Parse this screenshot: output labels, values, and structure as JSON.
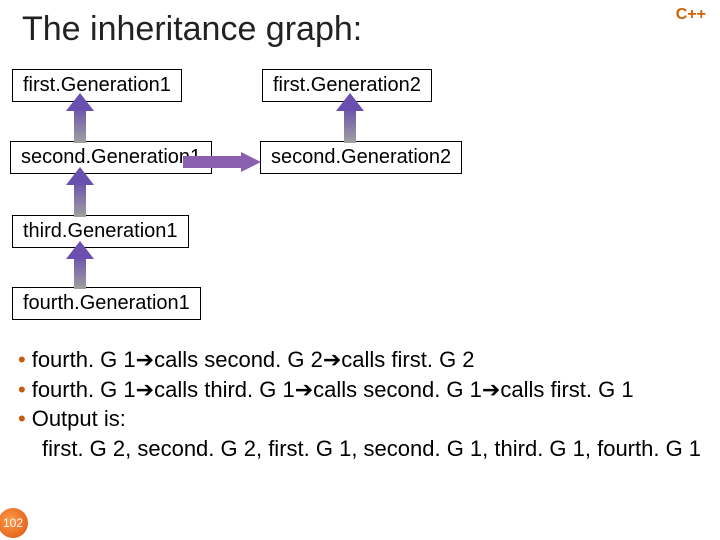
{
  "title": "The inheritance graph:",
  "lang": "C++",
  "nodes": {
    "fg1": "first.Generation1",
    "fg2": "first.Generation2",
    "sg1": "second.Generation1",
    "sg2": "second.Generation2",
    "tg1": "third.Generation1",
    "fo1": "fourth.Generation1"
  },
  "bullets": {
    "b1_parts": [
      "fourth. G 1",
      "calls second. G 2",
      "calls first. G 2"
    ],
    "b2_parts": [
      "fourth. G 1",
      "calls third. G 1",
      "calls second. G 1",
      "calls first. G 1"
    ],
    "b3": "Output is:",
    "b4": "first. G 2, second. G 2, first. G 1, second. G 1, third. G 1, fourth. G 1"
  },
  "arrow_glyph": "➔",
  "page": "102"
}
